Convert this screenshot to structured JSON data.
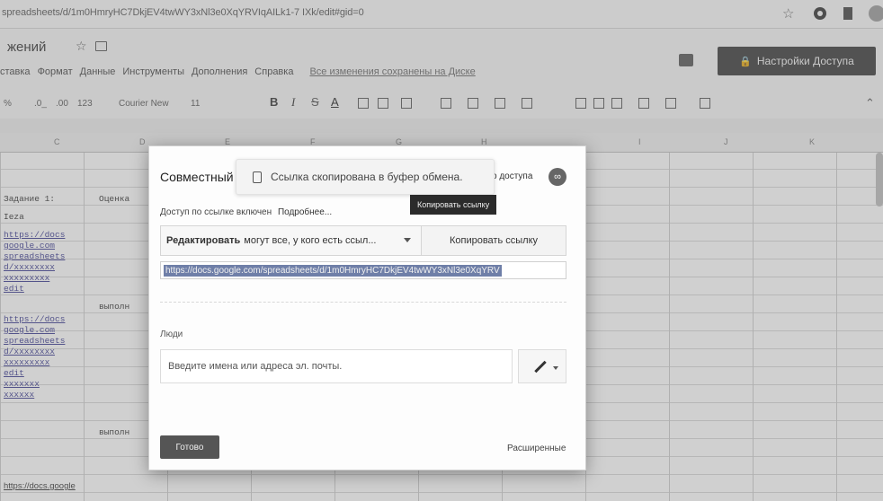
{
  "browser": {
    "url": "spreadsheets/d/1m0HmryHC7DkjEV4twWY3xNl3e0XqYRVIqAILk1-7 IXk/edit#gid=0"
  },
  "header": {
    "doc_title": "жений",
    "menu": [
      "ставка",
      "Формат",
      "Данные",
      "Инструменты",
      "Дополнения",
      "Справка"
    ],
    "saved_status": "Все изменения сохранены на Диске",
    "share_button": "Настройки Доступа"
  },
  "toolbar": {
    "percent": "%",
    "dec0": ".0_",
    "dec00": ".00",
    "format123": "123",
    "font": "Courier New",
    "font_size": "11",
    "bold": "B",
    "italic": "I",
    "strike": "S",
    "text_color": "A"
  },
  "columns": [
    "C",
    "D",
    "E",
    "F",
    "G",
    "H",
    "I",
    "J",
    "K"
  ],
  "sheet_cells": {
    "a_rows": [
      "Задание 1:",
      "Ieza",
      "https://docs",
      "google.com",
      "spreadsheets",
      "d/xxxxxxxx",
      "xxxxxxxxx",
      "edit",
      "https://docs",
      "google.com",
      "spreadsheets",
      "d/xxxxxxxx",
      "xxxxxxxxx",
      "edit",
      "xxxxxxx",
      "xxxxxx"
    ],
    "b_top": "Оценка",
    "b_mid": "выполн",
    "b_low": "выполн",
    "bottom": "https://docs.google"
  },
  "dialog": {
    "title": "Совместный",
    "access_settings": "о доступа",
    "toast": "Ссылка скопирована в буфер обмена.",
    "tooltip": "Копировать ссылку",
    "link_enabled": "Доступ по ссылке включен",
    "learn_more": "Подробнее...",
    "permission_bold": "Редактировать",
    "permission_rest": "могут все, у кого есть ссыл...",
    "copy_link_button": "Копировать ссылку",
    "link_url": "https://docs.google.com/spreadsheets/d/1m0HmryHC7DkjEV4twWY3xNl3e0XqYRV",
    "people_label": "Люди",
    "people_placeholder": "Введите имена или адреса эл. почты.",
    "done_button": "Готово",
    "advanced_link": "Расширенные"
  },
  "colors": {
    "share_button_bg": "#3a3a3a",
    "link_highlight": "#6f7fa8",
    "done_button_bg": "#555555"
  }
}
